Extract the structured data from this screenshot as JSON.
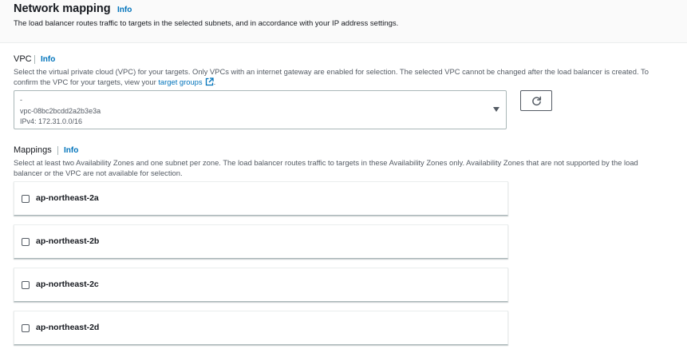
{
  "header": {
    "title": "Network mapping",
    "info": "Info",
    "description": "The load balancer routes traffic to targets in the selected subnets, and in accordance with your IP address settings."
  },
  "vpc": {
    "label": "VPC",
    "info": "Info",
    "description_1": "Select the virtual private cloud (VPC) for your targets. Only VPCs with an internet gateway are enabled for selection. The selected VPC cannot be changed after the load balancer is created. To",
    "description_2": "confirm the VPC for your targets, view your",
    "link": "target groups",
    "link_suffix": ".",
    "selected": {
      "name": "-",
      "id": "vpc-08bc2bcdd2a2b3e3a",
      "cidr": "IPv4: 172.31.0.0/16"
    }
  },
  "mappings": {
    "label": "Mappings",
    "info": "Info",
    "description_1": "Select at least two Availability Zones and one subnet per zone. The load balancer routes traffic to targets in these Availability Zones only. Availability Zones that are not supported by the load",
    "description_2": "balancer or the VPC are not available for selection.",
    "zones": [
      {
        "name": "ap-northeast-2a",
        "checked": false
      },
      {
        "name": "ap-northeast-2b",
        "checked": false
      },
      {
        "name": "ap-northeast-2c",
        "checked": false
      },
      {
        "name": "ap-northeast-2d",
        "checked": false
      }
    ]
  },
  "icons": {
    "external": "external-link-icon",
    "refresh": "refresh-icon",
    "caret": "caret-down-icon"
  },
  "colors": {
    "link": "#0073bb",
    "text": "#16191f",
    "muted": "#545b64",
    "border": "#aab7b8"
  }
}
